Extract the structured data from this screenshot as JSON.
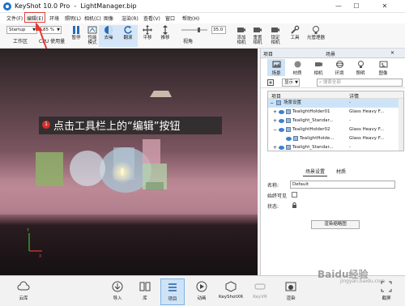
{
  "window": {
    "title": "KeyShot 10.0 Pro  -  LightManager.bip"
  },
  "menu": [
    "文件(F)",
    "编辑(E)",
    "环境",
    "照明(L)",
    "相机(C)",
    "图像",
    "渲染(R)",
    "查看(V)",
    "窗口",
    "帮助(H)"
  ],
  "toolbar": {
    "mode_value": "Startup",
    "zoom_value": "85 %",
    "workspace_label": "工作区",
    "cpu_label": "CPU 使用量",
    "pause_label": "暂停",
    "perf_label": "性能\n模式",
    "denoise_label": "去噪",
    "flip_label": "翻滚",
    "pan_label": "平移",
    "push_label": "推移",
    "fov_value": "35.0",
    "fov_label": "视角",
    "add_camera_label": "添加\n相机",
    "reset_camera_label": "重置\n相机",
    "lock_camera_label": "锁定\n相机",
    "tools_label": "工具",
    "light_manager_label": "光管理器"
  },
  "annotation": {
    "number": "1",
    "text": "点击工具栏上的“编辑”按钮"
  },
  "right_panel": {
    "tab_project": "项目",
    "tab_scene": "场景",
    "subtabs": [
      "场景",
      "材质",
      "相机",
      "环境",
      "照明",
      "图像"
    ],
    "display_label": "显示",
    "search_placeholder": "搜索全部",
    "col_item": "项目",
    "col_detail": "详情",
    "tree": [
      {
        "name": "场景设置",
        "detail": "-"
      },
      {
        "name": "TealightHolder01",
        "detail": "Glass Heavy F..."
      },
      {
        "name": "Tealight_Standar...",
        "detail": "-"
      },
      {
        "name": "TealightHolder02",
        "detail": "Glass Heavy F..."
      },
      {
        "name": "TealightHolde...",
        "detail": "Glass Heavy F..."
      },
      {
        "name": "Tealight_Standar...",
        "detail": "-"
      }
    ],
    "bottom_tabs": [
      "场景设置",
      "材质"
    ],
    "name_label": "名称:",
    "name_value": "Default",
    "always_visible_label": "始终可见",
    "status_label": "状态:",
    "render_thumbnail_label": "渲染缩略图"
  },
  "bottombar": {
    "buttons": [
      "云库",
      "导入",
      "库",
      "项目",
      "动画",
      "KeyShotXR",
      "KeyVR",
      "渲染",
      "截屏"
    ]
  },
  "watermark": {
    "text": "Baidu经验",
    "url": "jingyan.baidu.com"
  }
}
